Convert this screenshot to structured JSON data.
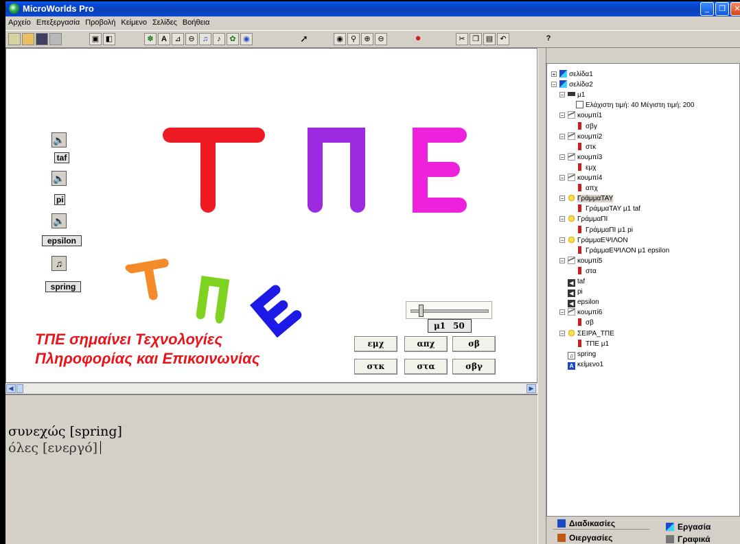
{
  "window": {
    "title": "MicroWorlds Pro"
  },
  "menu": [
    "Αρχείο",
    "Επεξεργασία",
    "Προβολή",
    "Κείμενο",
    "Σελίδες",
    "Βοήθεια"
  ],
  "toolbar_help": "?",
  "stage": {
    "big_letters": [
      "Τ",
      "Π",
      "Ε"
    ],
    "big_letter_colors": [
      "#ee1b24",
      "#9b2ae0",
      "#ee22dd"
    ],
    "sound_names": [
      "taf",
      "pi",
      "epsilon"
    ],
    "music_name": "spring",
    "slider": {
      "name": "μ1",
      "value": "50",
      "fraction": 0.125
    },
    "buttons": [
      [
        "εμχ",
        "απχ",
        "σβ"
      ],
      [
        "στκ",
        "στα",
        "σβγ"
      ]
    ],
    "text_lines": [
      "ΤΠΕ σημαίνει Τεχνολογίες",
      "Πληροφορίας και Επικοινωνίας"
    ]
  },
  "command_center": {
    "lines": [
      {
        "word": "συνεχώς",
        "arg": "[spring]"
      },
      {
        "word": "όλες",
        "arg": "[ενεργό]"
      }
    ]
  },
  "tree": [
    {
      "indent": 0,
      "exp": "+",
      "icon": "page",
      "label": "σελίδα1"
    },
    {
      "indent": 0,
      "exp": "−",
      "icon": "page",
      "label": "σελίδα2"
    },
    {
      "indent": 1,
      "exp": "−",
      "icon": "slider",
      "label": "μ1"
    },
    {
      "indent": 2,
      "exp": "",
      "icon": "box",
      "label": "Ελάχιστη τιμή: 40  Μέγιστη τιμή: 200"
    },
    {
      "indent": 1,
      "exp": "−",
      "icon": "button",
      "label": "κουμπί1"
    },
    {
      "indent": 2,
      "exp": "",
      "icon": "var",
      "label": "σβγ"
    },
    {
      "indent": 1,
      "exp": "−",
      "icon": "button",
      "label": "κουμπί2"
    },
    {
      "indent": 2,
      "exp": "",
      "icon": "var",
      "label": "στκ"
    },
    {
      "indent": 1,
      "exp": "−",
      "icon": "button",
      "label": "κουμπί3"
    },
    {
      "indent": 2,
      "exp": "",
      "icon": "var",
      "label": "εμχ"
    },
    {
      "indent": 1,
      "exp": "−",
      "icon": "button",
      "label": "κουμπί4"
    },
    {
      "indent": 2,
      "exp": "",
      "icon": "var",
      "label": "απχ"
    },
    {
      "indent": 1,
      "exp": "−",
      "icon": "turtle",
      "label": "ΓράμμαΤΑΥ",
      "selected": true
    },
    {
      "indent": 2,
      "exp": "",
      "icon": "var",
      "label": "ΓράμμαΤΑΥ μ1 taf"
    },
    {
      "indent": 1,
      "exp": "−",
      "icon": "turtle",
      "label": "ΓράμμαΠΙ"
    },
    {
      "indent": 2,
      "exp": "",
      "icon": "var",
      "label": "ΓράμμαΠΙ μ1 pi"
    },
    {
      "indent": 1,
      "exp": "−",
      "icon": "turtle",
      "label": "ΓράμμαΕΨΙΛΟΝ"
    },
    {
      "indent": 2,
      "exp": "",
      "icon": "var",
      "label": "ΓράμμαΕΨΙΛΟΝ μ1 epsilon"
    },
    {
      "indent": 1,
      "exp": "−",
      "icon": "button",
      "label": "κουμπί5"
    },
    {
      "indent": 2,
      "exp": "",
      "icon": "var",
      "label": "στα"
    },
    {
      "indent": 1,
      "exp": "",
      "icon": "sound",
      "label": "taf"
    },
    {
      "indent": 1,
      "exp": "",
      "icon": "sound",
      "label": "pi"
    },
    {
      "indent": 1,
      "exp": "",
      "icon": "sound",
      "label": "epsilon"
    },
    {
      "indent": 1,
      "exp": "−",
      "icon": "button",
      "label": "κουμπί6"
    },
    {
      "indent": 2,
      "exp": "",
      "icon": "var",
      "label": "σβ"
    },
    {
      "indent": 1,
      "exp": "−",
      "icon": "turtle",
      "label": "ΣΕΙΡΑ_ΤΠΕ"
    },
    {
      "indent": 2,
      "exp": "",
      "icon": "var",
      "label": "ΤΠΕ μ1"
    },
    {
      "indent": 1,
      "exp": "",
      "icon": "music",
      "label": "spring"
    },
    {
      "indent": 1,
      "exp": "",
      "icon": "text",
      "label": "κείμενο1"
    }
  ],
  "tabs": {
    "procedures": "Διαδικασίες",
    "project": "Εργασία",
    "operations": "Οιεργασίες",
    "graphics": "Γραφικά"
  }
}
